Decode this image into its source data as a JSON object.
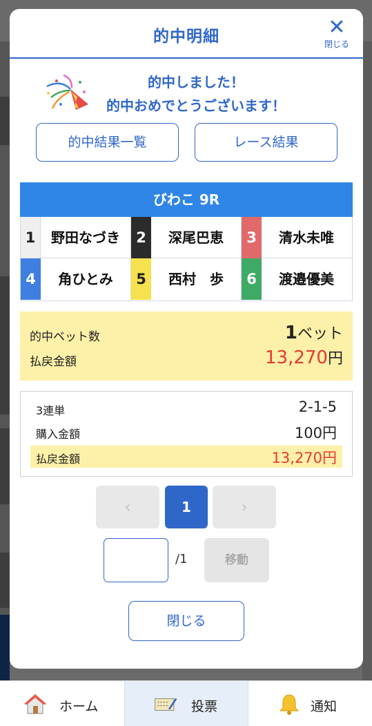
{
  "modal": {
    "title": "的中明細",
    "close_label": "閉じる"
  },
  "celebration": {
    "line1": "的中しました！",
    "line2": "的中おめでとうございます！"
  },
  "buttons": {
    "results_list": "的中結果一覧",
    "race_results": "レース結果",
    "close": "閉じる"
  },
  "race": {
    "name": "びわこ 9R",
    "racers": [
      {
        "num": "1",
        "name": "野田なづき"
      },
      {
        "num": "2",
        "name": "深尾巴恵"
      },
      {
        "num": "3",
        "name": "清水未唯"
      },
      {
        "num": "4",
        "name": "角ひとみ"
      },
      {
        "num": "5",
        "name": "西村　歩"
      },
      {
        "num": "6",
        "name": "渡邉優美"
      }
    ]
  },
  "summary": {
    "bet_count_label": "的中ベット数",
    "bet_count_value": "1",
    "bet_count_unit": "ベット",
    "payout_label": "払戻金額",
    "payout_value": "13,270",
    "payout_unit": "円"
  },
  "detail": {
    "bet_type": "3連単",
    "combination": "2-1-5",
    "purchase_label": "購入金額",
    "purchase_value": "100円",
    "payout_label": "払戻金額",
    "payout_value": "13,270円"
  },
  "pagination": {
    "prev": "‹",
    "current": "1",
    "next": "›",
    "page_input_value": "",
    "total": "/1",
    "move_label": "移動"
  },
  "tabbar": {
    "home": "ホーム",
    "vote": "投票",
    "notify": "通知"
  },
  "colors": {
    "accent": "#2f67c9",
    "race_bar": "#2f86e6",
    "highlight": "#fdf0a8",
    "payout_red": "#e53935"
  }
}
